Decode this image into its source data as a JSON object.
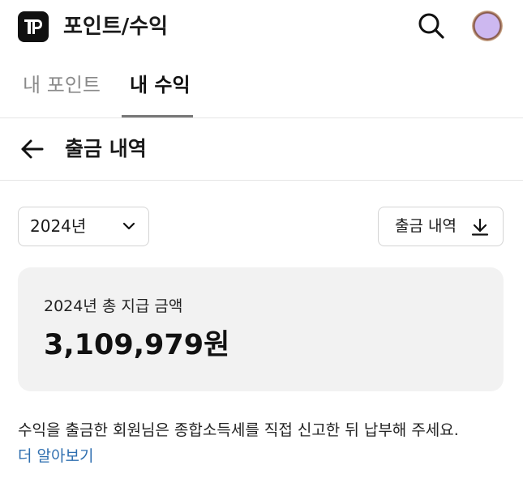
{
  "header": {
    "logo_text": "TP",
    "title": "포인트/수익"
  },
  "tabs": [
    {
      "label": "내 포인트"
    },
    {
      "label": "내 수익"
    }
  ],
  "subheader": {
    "title": "출금 내역"
  },
  "filters": {
    "year_value": "2024년",
    "download_label": "출금 내역"
  },
  "summary": {
    "label": "2024년 총 지급 금액",
    "amount": "3,109,979원"
  },
  "notice": {
    "text": "수익을 출금한 회원님은 종합소득세를 직접 신고한 뒤 납부해 주세요.",
    "link": "더 알아보기"
  },
  "colors": {
    "link": "#2f6fb0",
    "card_bg": "#f2f2f2",
    "logo_bg": "#111111"
  },
  "icons": [
    "search-icon",
    "arrow-left-icon",
    "chevron-down-icon",
    "download-icon",
    "avatar"
  ]
}
